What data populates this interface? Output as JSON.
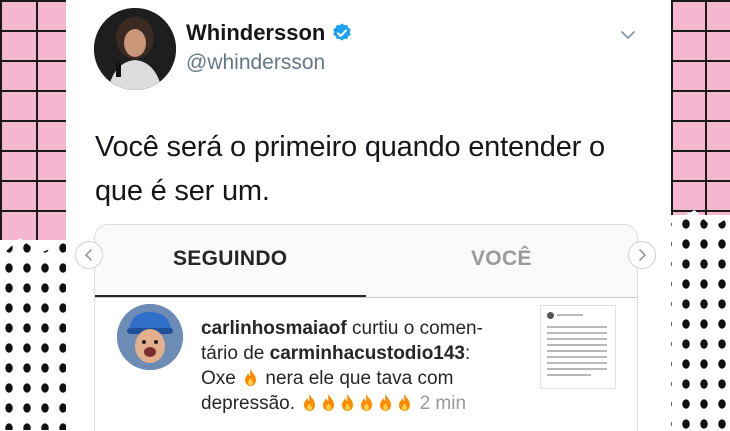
{
  "tweet": {
    "display_name": "Whindersson",
    "handle": "@whindersson",
    "text": "Você será o primeiro quando entender o que é ser um."
  },
  "instagram": {
    "tabs": [
      {
        "label": "SEGUINDO",
        "active": true
      },
      {
        "label": "VOCÊ",
        "active": false
      }
    ],
    "notification": {
      "user": "carlinhosmaiaof",
      "action_1": " curtiu o comen-",
      "action_2": "tário de ",
      "mention": "carminhacustodio143",
      "colon": ":",
      "comment_start": "Oxe ",
      "comment_mid": " nera ele que tava com",
      "comment_end": "depressão. ",
      "time": " 2 min"
    }
  },
  "colors": {
    "verified": "#1da1f2",
    "brick_pink": "#f5b6cf",
    "fire": "#ff8a00"
  },
  "icons": [
    "verified-badge-icon",
    "chevron-down-icon",
    "fire-emoji-icon",
    "left-arrow-icon",
    "right-arrow-icon"
  ]
}
